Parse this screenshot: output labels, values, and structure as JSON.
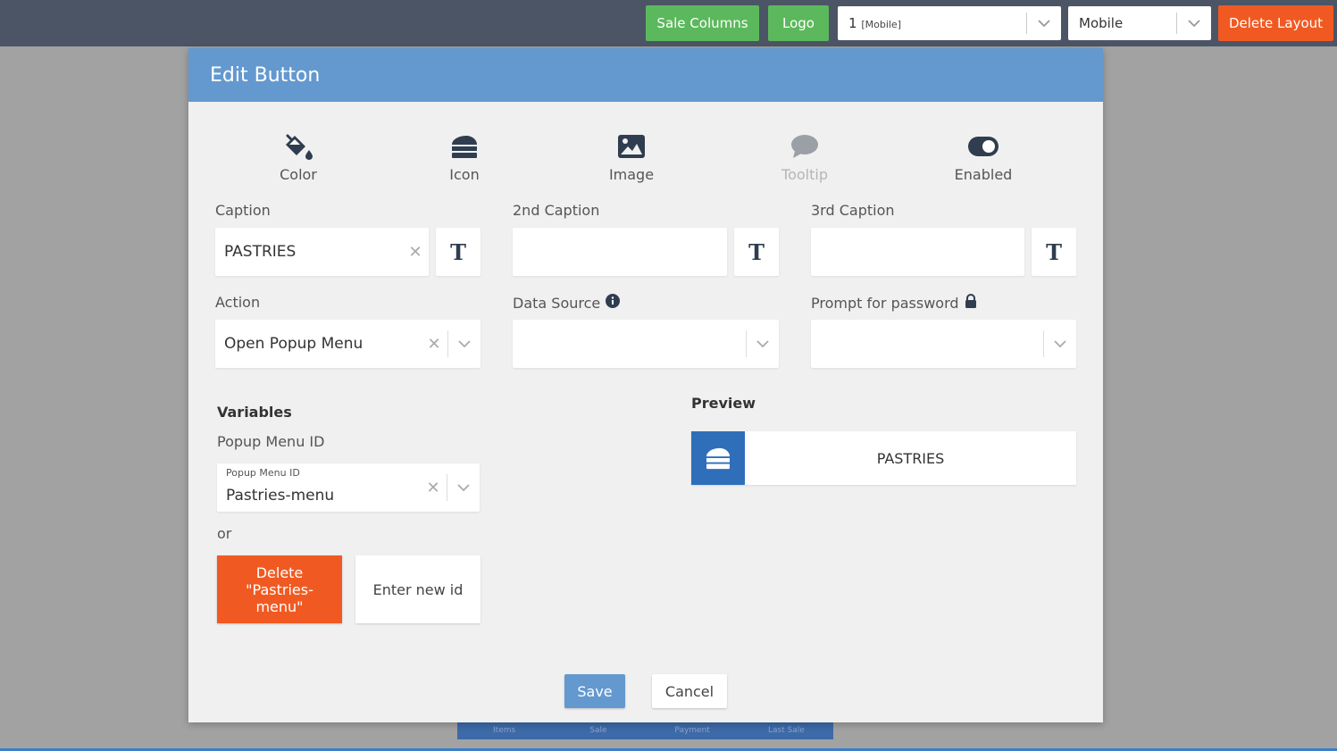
{
  "topbar": {
    "sale_columns": "Sale Columns",
    "logo": "Logo",
    "layout_select": {
      "value": "1",
      "note": "[Mobile]"
    },
    "device_select": "Mobile",
    "delete_layout": "Delete Layout"
  },
  "background": {
    "tabs": [
      "Items",
      "Sale",
      "Payment",
      "Last Sale"
    ]
  },
  "modal": {
    "title": "Edit Button",
    "tools": [
      {
        "label": "Color",
        "icon": "paint-bucket-icon"
      },
      {
        "label": "Icon",
        "icon": "cake-slice-icon"
      },
      {
        "label": "Image",
        "icon": "image-icon"
      },
      {
        "label": "Tooltip",
        "icon": "comment-icon"
      },
      {
        "label": "Enabled",
        "icon": "toggle-on-icon"
      }
    ],
    "caption": {
      "label": "Caption",
      "value": "PASTRIES"
    },
    "caption2": {
      "label": "2nd Caption",
      "value": ""
    },
    "caption3": {
      "label": "3rd Caption",
      "value": ""
    },
    "text_button": "T",
    "action": {
      "label": "Action",
      "value": "Open Popup Menu"
    },
    "data_source": {
      "label": "Data Source",
      "value": ""
    },
    "prompt_password": {
      "label": "Prompt for password",
      "value": ""
    },
    "variables": {
      "heading": "Variables",
      "popup_label": "Popup Menu ID",
      "popup_small_label": "Popup Menu ID",
      "popup_value": "Pastries-menu",
      "or": "or",
      "delete_label": "Delete \"Pastries-menu\"",
      "new_id_label": "Enter new id"
    },
    "preview": {
      "heading": "Preview",
      "caption": "PASTRIES"
    },
    "save": "Save",
    "cancel": "Cancel"
  },
  "colors": {
    "header": "#6499cf",
    "accent_orange": "#f05a22",
    "green": "#5cb85c",
    "topbar": "#4b5565",
    "preview_icon_bg": "#2f6fba"
  }
}
